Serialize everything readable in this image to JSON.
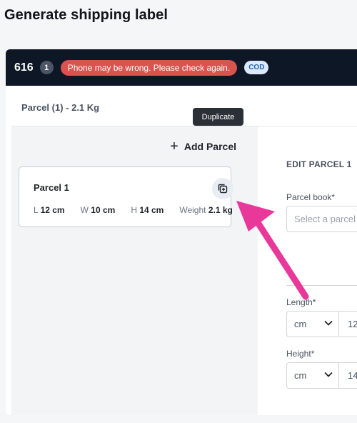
{
  "page": {
    "title": "Generate shipping label"
  },
  "order": {
    "id": "616",
    "count": "1",
    "warning": "Phone may be wrong. Please check again.",
    "payment_tag": "COD"
  },
  "summary": {
    "label": "Parcel (1) - 2.1 Kg"
  },
  "parcels": {
    "add_label": "Add Parcel",
    "items": [
      {
        "name": "Parcel 1",
        "length_label": "L",
        "length": "12 cm",
        "width_label": "W",
        "width": "10 cm",
        "height_label": "H",
        "height": "14 cm",
        "weight_label": "Weight",
        "weight": "2.1 kg"
      }
    ],
    "duplicate_tooltip": "Duplicate"
  },
  "edit": {
    "title": "EDIT PARCEL 1",
    "parcel_book_label": "Parcel book",
    "parcel_book_placeholder": "Select a parcel",
    "length_label": "Length",
    "length_unit": "cm",
    "length_value": "12",
    "height_label": "Height",
    "height_unit": "cm",
    "height_value": "14",
    "required_mark": "*"
  },
  "colors": {
    "header_bg": "#0e1726",
    "warning_bg": "#d9534f",
    "cod_bg": "#dbeafe",
    "annotation_arrow": "#e8399a"
  },
  "icons": {
    "add": "plus-icon",
    "duplicate": "duplicate-icon",
    "select": "chevron-down-icon",
    "annotation": "pointer-arrow-icon"
  }
}
